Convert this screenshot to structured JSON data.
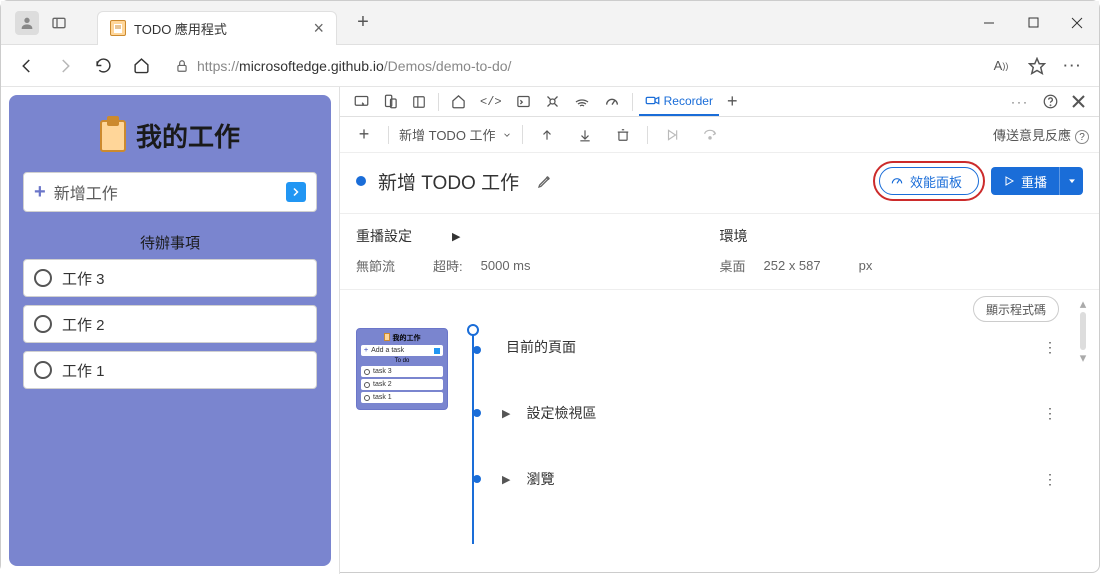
{
  "browser": {
    "tab_title": "TODO 應用程式",
    "url_scheme": "https://",
    "url_domain": "microsoftedge.github.io",
    "url_path": "/Demos/demo-to-do/"
  },
  "app": {
    "title": "我的工作",
    "add_label": "新增工作",
    "todo_heading": "待辦事項",
    "tasks": [
      "工作 3",
      "工作 2",
      "工作 1"
    ]
  },
  "thumb": {
    "title": "我的工作",
    "add": "Add a task",
    "heading": "To do",
    "tasks": [
      "task 3",
      "task 2",
      "task 1"
    ]
  },
  "dev": {
    "recorder_tab": "Recorder",
    "recording_dropdown": "新增 TODO 工作",
    "feedback": "傳送意見反應",
    "recording_title": "新增 TODO 工作",
    "perf_button": "效能面板",
    "replay_button": "重播",
    "settings_heading": "重播設定",
    "throttle_label": "無節流",
    "timeout_label": "超時:",
    "timeout_value": "5000 ms",
    "env_heading": "環境",
    "env_label": "桌面",
    "env_value": "252 x 587",
    "env_unit": "px",
    "show_code": "顯示程式碼",
    "steps": [
      "目前的頁面",
      "設定檢視區",
      "瀏覽"
    ]
  }
}
